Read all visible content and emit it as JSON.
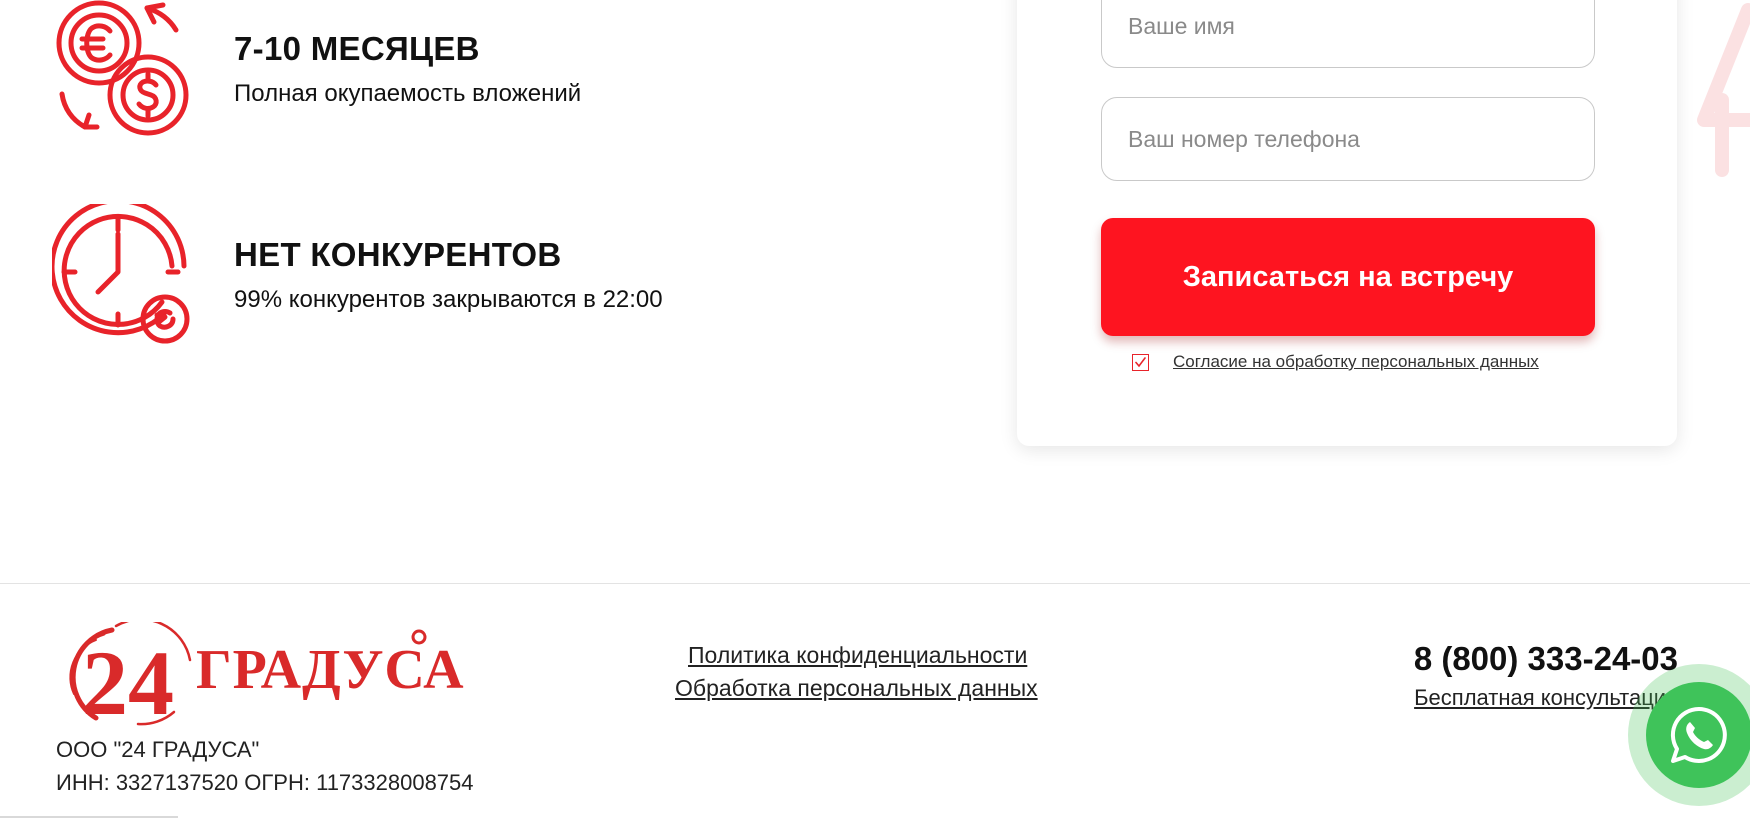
{
  "benefits": [
    {
      "icon": "currency-exchange-icon",
      "title": "7-10 МЕСЯЦЕВ",
      "text": "Полная окупаемость вложений"
    },
    {
      "icon": "clock-icon",
      "title": "НЕТ КОНКУРЕНТОВ",
      "text": "99% конкурентов закрываются в 22:00"
    }
  ],
  "form": {
    "name_placeholder": "Ваше имя",
    "phone_placeholder": "Ваш номер телефона",
    "submit_label": "Записаться на встречу",
    "consent_checked": true,
    "consent_label": "Согласие на обработку персональных данных"
  },
  "footer": {
    "logo": {
      "number": "24",
      "word": "ГРАДУСА",
      "degree": "°"
    },
    "company_name": "ООО \"24 ГРАДУСА\"",
    "company_ids": "ИНН: 3327137520 ОГРН: 1173328008754",
    "links": {
      "privacy": "Политика конфиденциальности",
      "data_processing": "Обработка персональных данных"
    },
    "phone": "8 (800) 333-24-03",
    "consult_label": "Бесплатная консультация"
  },
  "whatsapp": {
    "icon": "whatsapp-icon"
  },
  "colors": {
    "accent": "#fe1420",
    "icon_red": "#e8232a",
    "logo_red": "#d92a2a",
    "whatsapp_green": "#3fc35a"
  }
}
